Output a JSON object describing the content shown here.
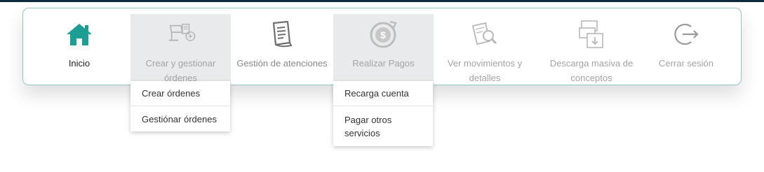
{
  "nav": {
    "items": [
      {
        "label": "Inicio",
        "icon": "home-icon"
      },
      {
        "label": "Crear y gestionar órdenes",
        "icon": "orders-icon"
      },
      {
        "label": "Gestión de atenciones",
        "icon": "document-icon"
      },
      {
        "label": "Realizar Pagos",
        "icon": "payment-icon"
      },
      {
        "label": "Ver movimientos y detalles",
        "icon": "movements-search-icon"
      },
      {
        "label": "Descarga masiva de conceptos",
        "icon": "bulk-download-icon"
      },
      {
        "label": "Cerrar sesión",
        "icon": "logout-icon"
      }
    ]
  },
  "dropdowns": {
    "orders": [
      "Crear órdenes",
      "Gestiónar órdenes"
    ],
    "payments": [
      "Recarga cuenta",
      "Pagar otros servicios"
    ]
  },
  "colors": {
    "accent": "#1b9e94",
    "border": "#8fc9c2",
    "active_bg": "#e9eaec",
    "muted_text": "#a4a4a4"
  }
}
